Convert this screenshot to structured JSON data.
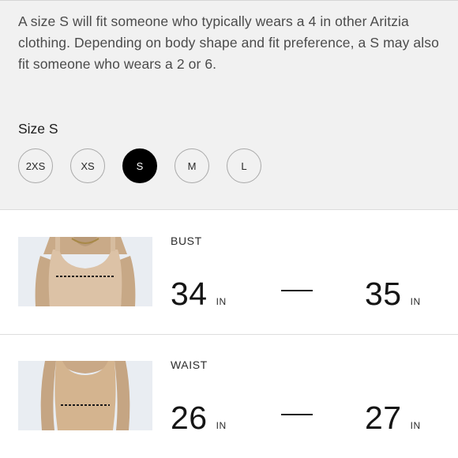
{
  "fit_note": "A size S will fit someone who typically wears a 4 in other Aritzia clothing. Depending on body shape and fit preference, a S may also fit someone who wears a 2 or 6.",
  "size_selector": {
    "label": "Size S",
    "options": [
      "2XS",
      "XS",
      "S",
      "M",
      "L"
    ],
    "selected": "S"
  },
  "measurements": [
    {
      "title": "BUST",
      "min": "34",
      "max": "35",
      "unit": "IN",
      "icon": "bust-measurement-photo"
    },
    {
      "title": "WAIST",
      "min": "26",
      "max": "27",
      "unit": "IN",
      "icon": "waist-measurement-photo"
    }
  ],
  "colors": {
    "panel_bg": "#f1f1f1",
    "selected_pill": "#000000",
    "skin": "#c7a886",
    "garment": "#d8bea2",
    "photo_bg": "#e9edf2"
  }
}
